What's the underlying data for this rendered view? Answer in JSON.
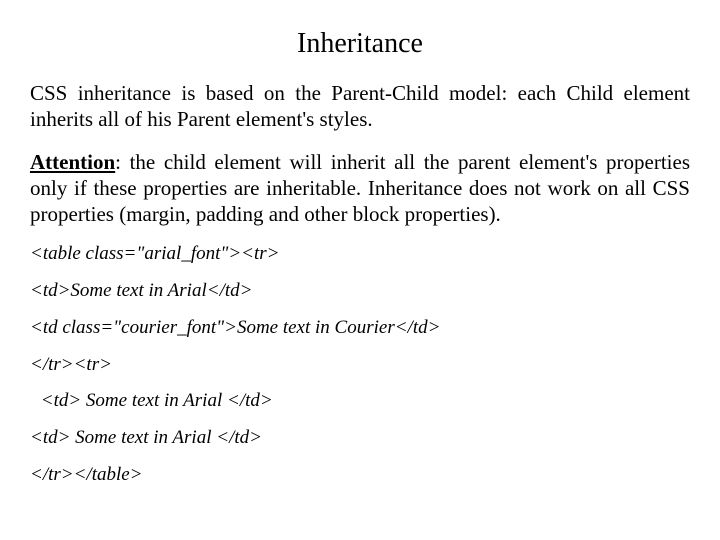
{
  "title": "Inheritance",
  "para1": "CSS inheritance is based on the Parent-Child model: each Child element inherits all of his Parent element's styles.",
  "attention_label": "Attention",
  "para2_rest": ": the child element will inherit all the parent element's properties only if these properties are inheritable. Inheritance does not work on all CSS properties (margin, padding and other block properties).",
  "code": {
    "l1": "<table class=\"arial_font\"><tr>",
    "l2": "<td>Some text in Arial</td>",
    "l3": "<td class=\"courier_font\">Some text in Courier</td>",
    "l4": "</tr><tr>",
    "l5": " <td> Some text in Arial </td>",
    "l6": "<td> Some text in Arial </td>",
    "l7": "</tr></table>"
  }
}
